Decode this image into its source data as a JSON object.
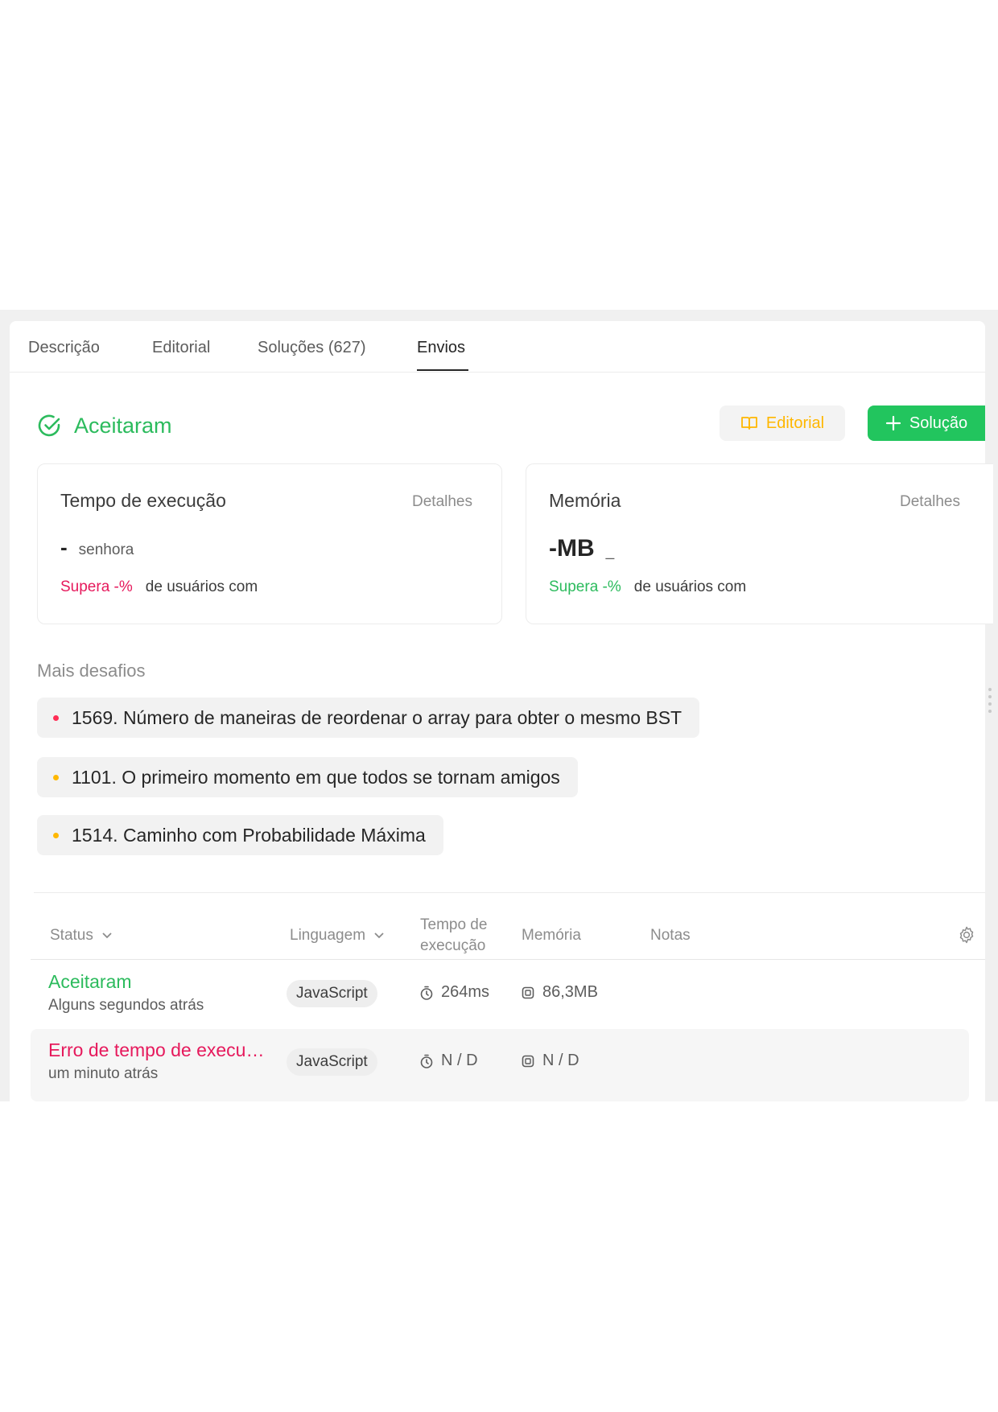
{
  "tabs": [
    {
      "label": "Descrição"
    },
    {
      "label": "Editorial"
    },
    {
      "label": "Soluções (627)"
    },
    {
      "label": "Envios"
    }
  ],
  "result": {
    "status": "Aceitaram",
    "editorial_button": "Editorial",
    "solution_button": "Solução"
  },
  "runtime_card": {
    "title": "Tempo de execução",
    "details": "Detalhes",
    "value": "-",
    "unit": "senhora",
    "beats": "Supera -%",
    "beats_suffix": "de usuários com"
  },
  "memory_card": {
    "title": "Memória",
    "details": "Detalhes",
    "value": "-MB",
    "unit": "_",
    "beats": "Supera -%",
    "beats_suffix": "de usuários com"
  },
  "challenges": {
    "title": "Mais desafios",
    "items": [
      {
        "label": "1569. Número de maneiras de reordenar o array para obter o mesmo BST",
        "color": "#ff2d55"
      },
      {
        "label": "1101. O primeiro momento em que todos se tornam amigos",
        "color": "#ffb800"
      },
      {
        "label": "1514. Caminho com Probabilidade Máxima",
        "color": "#ffb800"
      }
    ]
  },
  "table": {
    "headers": {
      "status": "Status",
      "language": "Linguagem",
      "runtime_line1": "Tempo de",
      "runtime_line2": "execução",
      "memory": "Memória",
      "notes": "Notas"
    },
    "rows": [
      {
        "status": "Aceitaram",
        "time": "Alguns segundos atrás",
        "language": "JavaScript",
        "runtime": "264ms",
        "memory": "86,3MB",
        "status_color": "#2cbb5d"
      },
      {
        "status": "Erro de tempo de execu…",
        "time": "um minuto atrás",
        "language": "JavaScript",
        "runtime": "N / D",
        "memory": "N / D",
        "status_color": "#e6195c"
      }
    ]
  },
  "icons": {
    "accepted": "check-circle-icon",
    "editorial": "book-icon",
    "solution": "plus-icon",
    "settings": "gear-icon",
    "runtime": "stopwatch-icon",
    "memory": "chip-icon"
  }
}
